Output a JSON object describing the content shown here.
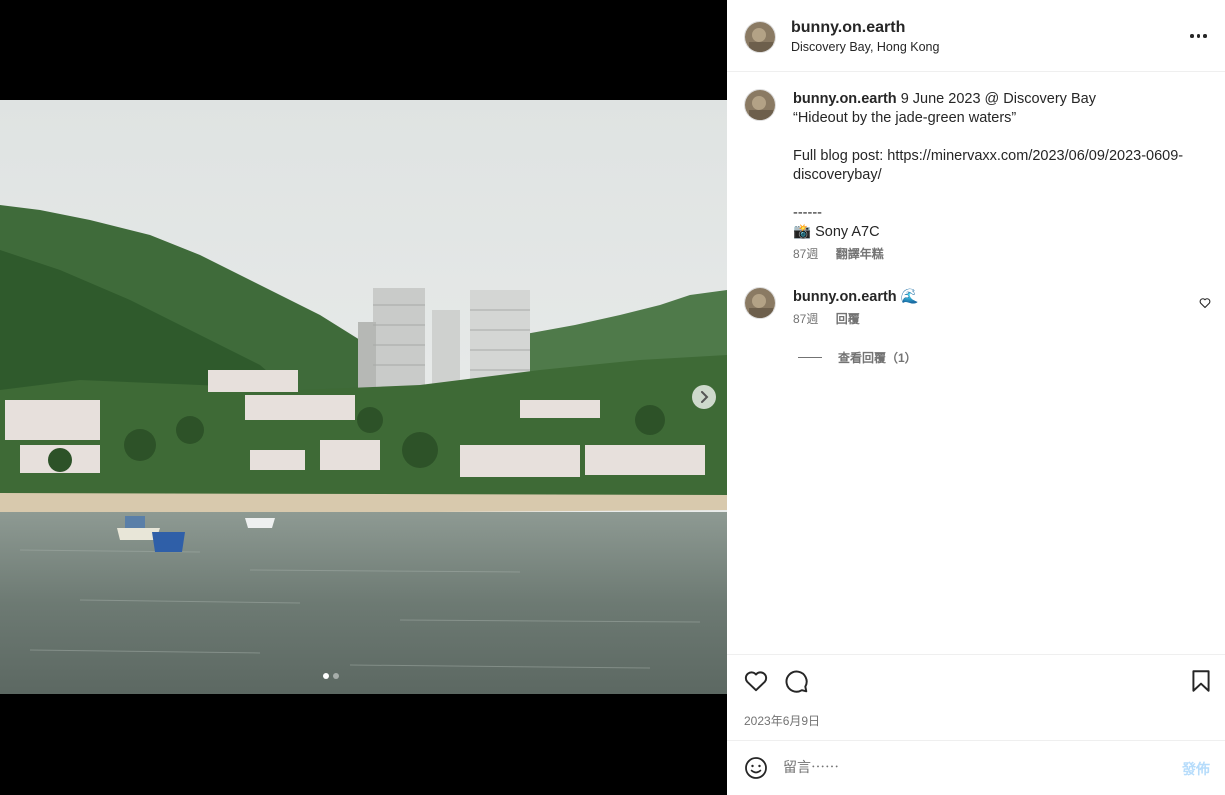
{
  "post": {
    "username": "bunny.on.earth",
    "location": "Discovery Bay, Hong Kong",
    "date": "2023年6月9日"
  },
  "caption": {
    "username": "bunny.on.earth",
    "lines": [
      "9 June 2023 @ Discovery Bay",
      "“Hideout by the jade-green waters”",
      "",
      "Full blog post: https://minervaxx.com/2023/06/09/2023-0609-discoverybay/",
      "",
      "------",
      "📸 Sony A7C"
    ],
    "age": "87週",
    "translate_label": "翻譯年糕"
  },
  "comment": {
    "username": "bunny.on.earth",
    "text": "🌊",
    "age": "87週",
    "reply_label": "回覆",
    "view_replies_label": "查看回覆（1）"
  },
  "composer": {
    "placeholder": "留言⋯⋯",
    "post_label": "發佈"
  },
  "carousel": {
    "slide_count": 2,
    "active_index": 0
  },
  "icons": {
    "more": "more-options-icon",
    "next": "chevron-right-icon",
    "like": "heart-icon",
    "comment": "comment-bubble-icon",
    "save": "bookmark-icon",
    "emoji": "emoji-smile-icon"
  }
}
